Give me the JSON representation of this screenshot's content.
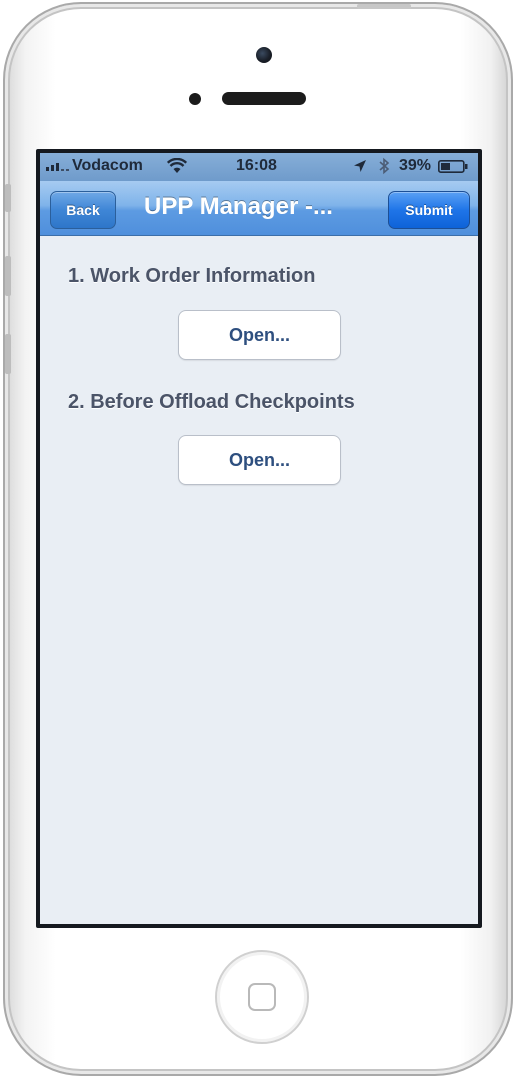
{
  "status_bar": {
    "carrier": "Vodacom",
    "time": "16:08",
    "battery_percent": "39%",
    "icons": [
      "signal-icon",
      "wifi-icon",
      "location-icon",
      "bluetooth-icon",
      "battery-icon"
    ]
  },
  "nav_bar": {
    "back_label": "Back",
    "title": "UPP Manager -...",
    "submit_label": "Submit"
  },
  "sections": [
    {
      "label": "1. Work Order Information",
      "button_label": "Open..."
    },
    {
      "label": "2. Before Offload Checkpoints",
      "button_label": "Open..."
    }
  ],
  "colors": {
    "nav_bar": "#5d9be2",
    "submit_button": "#1f75e8",
    "background": "#e9eef4",
    "section_text": "#4b5468",
    "button_text": "#2e4f7f"
  }
}
